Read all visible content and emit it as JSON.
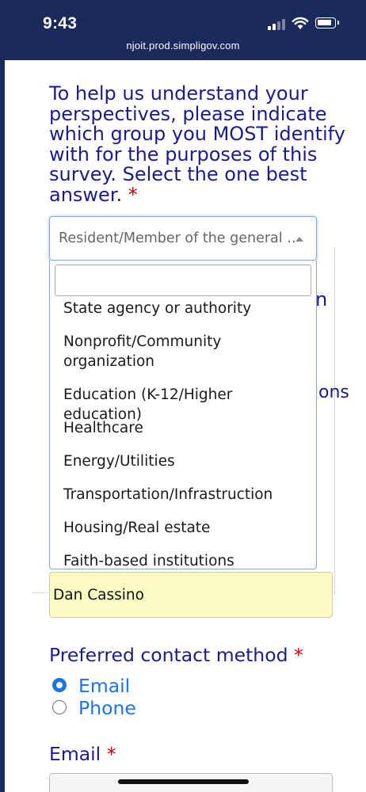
{
  "status_bar": {
    "time": "9:43",
    "url": "njoit.prod.simpligov.com",
    "icons": [
      "signal-icon",
      "wifi-icon",
      "battery-icon"
    ]
  },
  "form": {
    "question": "To help us understand your perspectives, please indicate which group you MOST identify with for the purposes of this survey. Select the one best answer.",
    "required_mark": "*",
    "group_select": {
      "selected": "Resident/Member of the general …",
      "search_value": "",
      "options": [
        "State agency or authority",
        "Nonprofit/Community organization",
        "Education (K-12/Higher education)",
        "Healthcare",
        "Energy/Utilities",
        "Transportation/Infrastruction",
        "Housing/Real estate",
        "Faith-based institutions"
      ]
    },
    "background_fragments": [
      "n",
      "ons"
    ],
    "name_value": "Dan Cassino",
    "contact": {
      "label": "Preferred contact method",
      "options": [
        "Email",
        "Phone"
      ],
      "selected": "Email"
    },
    "email_label": "Email",
    "email_value": ""
  },
  "colors": {
    "header_bg": "#1b2a5c",
    "label_text": "#1c1b8e",
    "required": "#c00000",
    "accent": "#1a73e8",
    "autofill_bg": "#fafac4"
  }
}
